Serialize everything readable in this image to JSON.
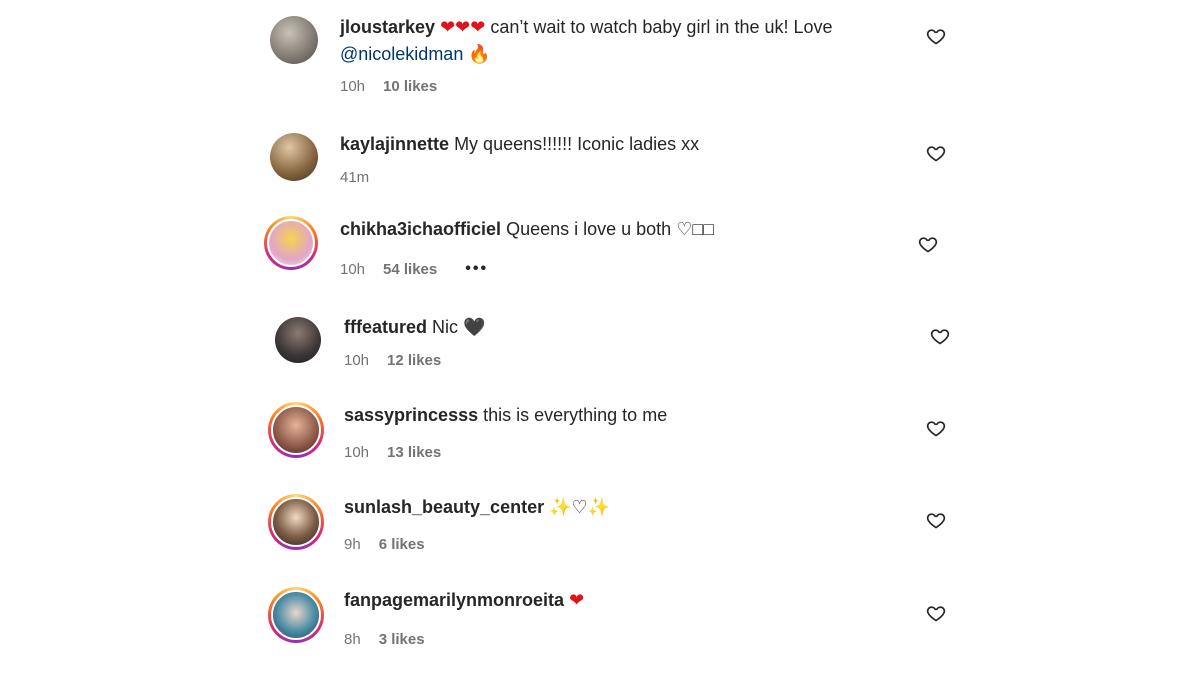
{
  "comments": [
    {
      "username": "jloustarkey",
      "text": "can’t wait to watch baby girl in the uk! Love",
      "mention": "@nicolekidman",
      "emoji_prefix": "❤❤❤",
      "emoji_suffix": "🔥",
      "time": "10h",
      "likes": "10 likes"
    },
    {
      "username": "kaylajinnette",
      "text": "My queens!!!!!! Iconic ladies xx",
      "time": "41m"
    },
    {
      "username": "chikha3ichaofficiel",
      "text": "Queens i love u both",
      "emoji_suffix": "♡",
      "missing_glyphs": "□□",
      "time": "10h",
      "likes": "54 likes",
      "more": "•••"
    },
    {
      "username": "fffeatured",
      "text": "Nic",
      "emoji_suffix": "🖤",
      "time": "10h",
      "likes": "12 likes"
    },
    {
      "username": "sassyprincesss",
      "text": "this is everything to me",
      "time": "10h",
      "likes": "13 likes"
    },
    {
      "username": "sunlash_beauty_center",
      "emoji_text": "✨♡✨",
      "time": "9h",
      "likes": "6 likes"
    },
    {
      "username": "fanpagemarilynmonroeita",
      "emoji_text": "❤",
      "time": "8h",
      "likes": "3 likes"
    }
  ],
  "icons": {
    "like": "heart-outline-icon"
  },
  "colors": {
    "mention": "#00376b",
    "meta": "#737373",
    "heart_red": "#e0131d"
  }
}
